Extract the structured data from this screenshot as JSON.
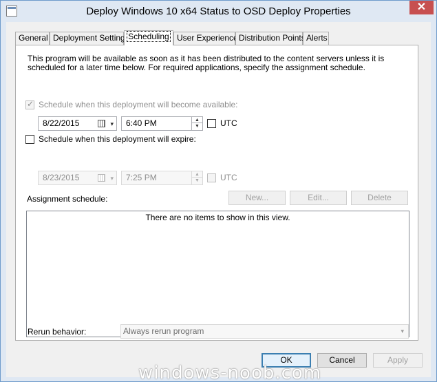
{
  "window": {
    "title": "Deploy Windows 10 x64 Status to OSD Deploy Properties",
    "close_glyph": "✕"
  },
  "tabs": [
    {
      "label": "General",
      "active": false
    },
    {
      "label": "Deployment Settings",
      "active": false
    },
    {
      "label": "Scheduling",
      "active": true
    },
    {
      "label": "User Experience",
      "active": false
    },
    {
      "label": "Distribution Points",
      "active": false
    },
    {
      "label": "Alerts",
      "active": false
    }
  ],
  "scheduling": {
    "description": "This program will be available as soon as it has been distributed to the content servers unless it is scheduled for a later time below. For required applications, specify the assignment schedule.",
    "available": {
      "label": "Schedule when this deployment will become available:",
      "checked": true,
      "enabled": false,
      "date": "8/22/2015",
      "time": "6:40 PM",
      "utc_label": "UTC",
      "utc_checked": false
    },
    "expire": {
      "label": "Schedule when this deployment will expire:",
      "checked": false,
      "enabled": true,
      "date": "8/23/2015",
      "time": "7:25 PM",
      "utc_label": "UTC",
      "utc_checked": false
    },
    "assignment_label": "Assignment schedule:",
    "new_button": "New...",
    "edit_button": "Edit...",
    "delete_button": "Delete",
    "empty_list_text": "There are no items to show in this view.",
    "rerun_label": "Rerun behavior:",
    "rerun_value": "Always rerun program"
  },
  "footer": {
    "ok_label": "OK",
    "cancel_label": "Cancel",
    "apply_label": "Apply"
  },
  "watermark": "windows-noob.com",
  "icons": {
    "calendar": "calendar-icon",
    "dropdown": "▾",
    "spin_up": "▲",
    "spin_down": "▼"
  }
}
